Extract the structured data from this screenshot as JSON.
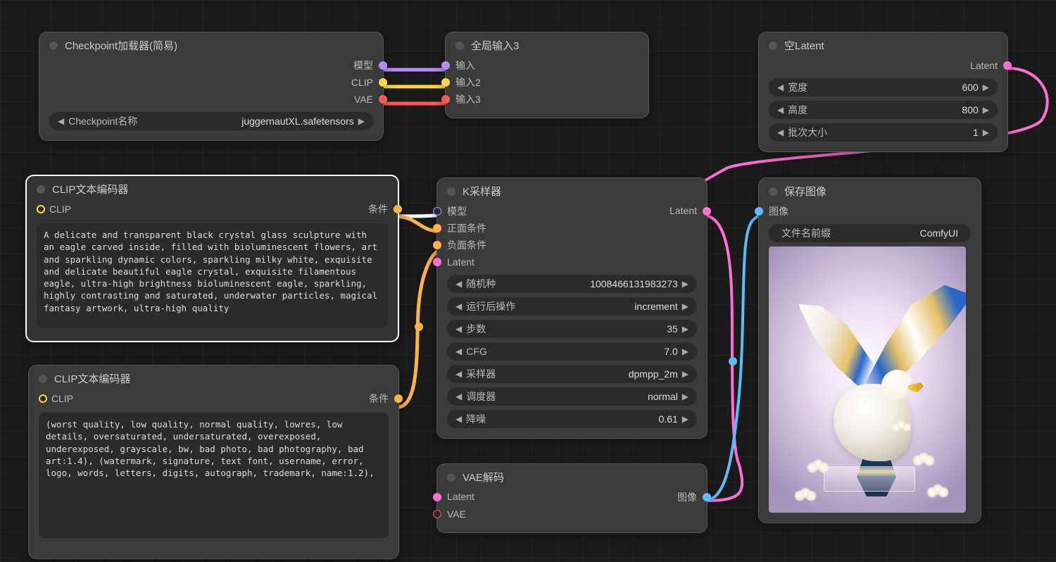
{
  "nodes": {
    "checkpoint": {
      "title": "Checkpoint加载器(简易)",
      "out_model": "模型",
      "out_clip": "CLIP",
      "out_vae": "VAE",
      "widget_label": "Checkpoint名称",
      "widget_value": "juggernautXL.safetensors"
    },
    "global_in": {
      "title": "全局输入3",
      "in1": "输入",
      "in2": "输入2",
      "in3": "输入3"
    },
    "empty_latent": {
      "title": "空Latent",
      "out_latent": "Latent",
      "width_label": "宽度",
      "width_value": "600",
      "height_label": "高度",
      "height_value": "800",
      "batch_label": "批次大小",
      "batch_value": "1"
    },
    "clip_pos": {
      "title": "CLIP文本编码器",
      "clip_in": "CLIP",
      "cond_out": "条件",
      "text": "A delicate and transparent black crystal glass sculpture with an eagle carved inside, filled with bioluminescent flowers, art and sparkling dynamic colors, sparkling milky white, exquisite and delicate beautiful eagle crystal, exquisite filamentous eagle, ultra-high brightness bioluminescent eagle, sparkling, highly contrasting and saturated, underwater particles, magical fantasy artwork, ultra-high quality"
    },
    "clip_neg": {
      "title": "CLIP文本编码器",
      "clip_in": "CLIP",
      "cond_out": "条件",
      "text": "(worst quality, low quality, normal quality, lowres, low details, oversaturated, undersaturated, overexposed, underexposed, grayscale, bw, bad photo, bad photography, bad art:1.4), (watermark, signature, text font, username, error, logo, words, letters, digits, autograph, trademark, name:1.2),"
    },
    "ksampler": {
      "title": "K采样器",
      "in_model": "模型",
      "in_pos": "正面条件",
      "in_neg": "负面条件",
      "in_latent": "Latent",
      "out_latent": "Latent",
      "seed_label": "随机种",
      "seed_value": "1008466131983273",
      "post_label": "运行后操作",
      "post_value": "increment",
      "steps_label": "步数",
      "steps_value": "35",
      "cfg_label": "CFG",
      "cfg_value": "7.0",
      "sampler_label": "采样器",
      "sampler_value": "dpmpp_2m",
      "scheduler_label": "调度器",
      "scheduler_value": "normal",
      "denoise_label": "降噪",
      "denoise_value": "0.61"
    },
    "vae_decode": {
      "title": "VAE解码",
      "in_latent": "Latent",
      "in_vae": "VAE",
      "out_image": "图像"
    },
    "save_image": {
      "title": "保存图像",
      "in_image": "图像",
      "prefix_label": "文件名前缀",
      "prefix_value": "ComfyUI"
    }
  }
}
